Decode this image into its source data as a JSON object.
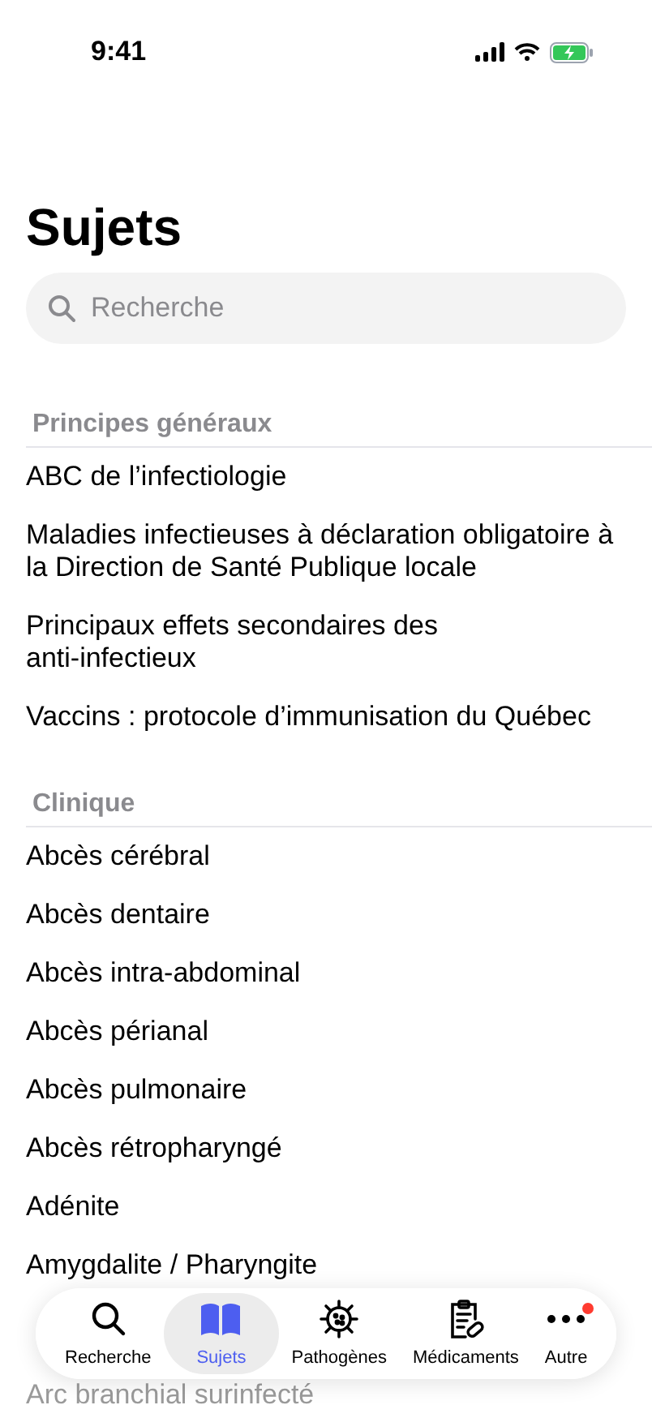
{
  "status_bar": {
    "time": "9:41"
  },
  "title": "Sujets",
  "search": {
    "placeholder": "Recherche"
  },
  "sections": [
    {
      "header": "Principes généraux",
      "items": [
        "ABC de l’infectiologie",
        "Maladies infectieuses à déclaration obligatoire à la Direction de Santé Publique locale",
        "Principaux effets secondaires des anti-infectieux",
        "Vaccins : protocole d’immunisation du Québec"
      ]
    },
    {
      "header": "Clinique",
      "items": [
        "Abcès cérébral",
        "Abcès dentaire",
        "Abcès intra-abdominal",
        "Abcès périanal",
        "Abcès pulmonaire",
        "Abcès rétropharyngé",
        "Adénite",
        "Amygdalite / Pharyngite"
      ],
      "below_tab_bar": [
        "Arc branchial surinfecté"
      ]
    }
  ],
  "tab_bar": [
    {
      "kind": "search",
      "label": "Recherche",
      "selected": false,
      "badge": false
    },
    {
      "kind": "book",
      "label": "Sujets",
      "selected": true,
      "badge": false
    },
    {
      "kind": "virus",
      "label": "Pathogènes",
      "selected": false,
      "badge": false
    },
    {
      "kind": "clipboard",
      "label": "Médicaments",
      "selected": false,
      "badge": false
    },
    {
      "kind": "more",
      "label": "Autre",
      "selected": false,
      "badge": true
    }
  ]
}
